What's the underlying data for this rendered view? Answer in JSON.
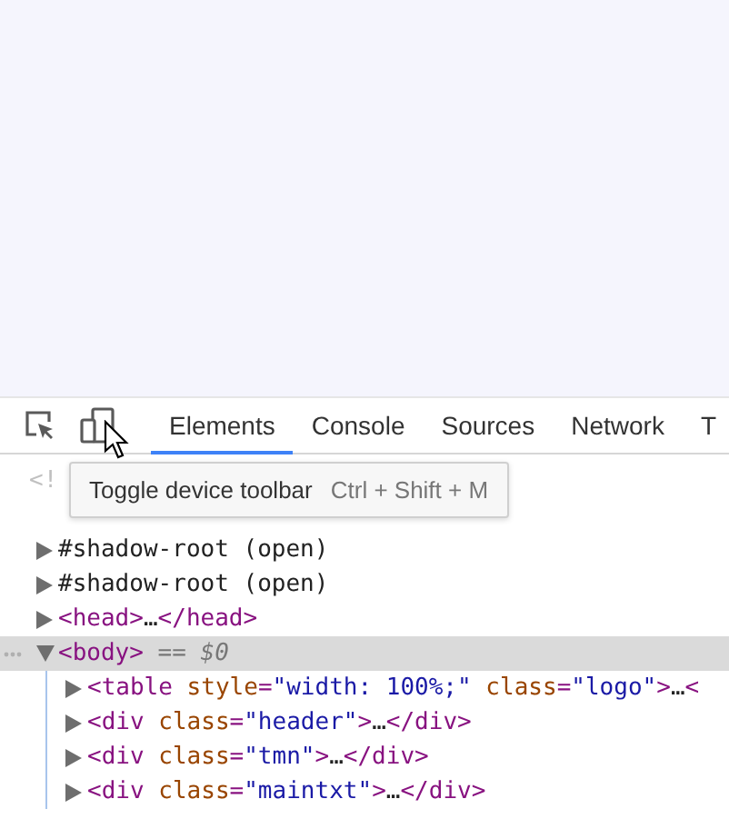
{
  "tabs": [
    {
      "label": "Elements",
      "selected": true
    },
    {
      "label": "Console",
      "selected": false
    },
    {
      "label": "Sources",
      "selected": false
    },
    {
      "label": "Network",
      "selected": false
    },
    {
      "label": "T",
      "selected": false
    }
  ],
  "tooltip": {
    "label": "Toggle device toolbar",
    "shortcut": "Ctrl + Shift + M"
  },
  "tree": [
    {
      "selected": false,
      "tokens": [
        {
          "kind": "doctype",
          "text": "<!"
        }
      ]
    },
    {
      "children": [
        {
          "selected": false,
          "expanded": false,
          "tokens": [
            {
              "kind": "plain",
              "text": "#shadow-root (open)"
            }
          ]
        },
        {
          "selected": false,
          "expanded": false,
          "tokens": [
            {
              "kind": "plain",
              "text": "#shadow-root (open)"
            }
          ]
        },
        {
          "selected": false,
          "expanded": false,
          "tokens": [
            {
              "kind": "tag",
              "text": "<head>"
            },
            {
              "kind": "plain",
              "text": "…"
            },
            {
              "kind": "tag",
              "text": "</head>"
            }
          ]
        },
        {
          "selected": true,
          "expanded": true,
          "tokens": [
            {
              "kind": "tag",
              "text": "<body>"
            },
            {
              "kind": "note",
              "text": " == $0"
            }
          ],
          "children": [
            {
              "selected": false,
              "expanded": false,
              "tokens": [
                {
                  "kind": "tag",
                  "text": "<table"
                },
                {
                  "kind": "attr",
                  "text": " style"
                },
                {
                  "kind": "tag",
                  "text": "="
                },
                {
                  "kind": "value",
                  "text": "\"width: 100%;\""
                },
                {
                  "kind": "attr",
                  "text": " class"
                },
                {
                  "kind": "tag",
                  "text": "="
                },
                {
                  "kind": "value",
                  "text": "\"logo\""
                },
                {
                  "kind": "tag",
                  "text": ">"
                },
                {
                  "kind": "plain",
                  "text": "…"
                },
                {
                  "kind": "tag",
                  "text": "<"
                }
              ]
            },
            {
              "selected": false,
              "expanded": false,
              "tokens": [
                {
                  "kind": "tag",
                  "text": "<div"
                },
                {
                  "kind": "attr",
                  "text": " class"
                },
                {
                  "kind": "tag",
                  "text": "="
                },
                {
                  "kind": "value",
                  "text": "\"header\""
                },
                {
                  "kind": "tag",
                  "text": ">"
                },
                {
                  "kind": "plain",
                  "text": "…"
                },
                {
                  "kind": "tag",
                  "text": "</div>"
                }
              ]
            },
            {
              "selected": false,
              "expanded": false,
              "tokens": [
                {
                  "kind": "tag",
                  "text": "<div"
                },
                {
                  "kind": "attr",
                  "text": " class"
                },
                {
                  "kind": "tag",
                  "text": "="
                },
                {
                  "kind": "value",
                  "text": "\"tmn\""
                },
                {
                  "kind": "tag",
                  "text": ">"
                },
                {
                  "kind": "plain",
                  "text": "…"
                },
                {
                  "kind": "tag",
                  "text": "</div>"
                }
              ]
            },
            {
              "selected": false,
              "expanded": false,
              "tokens": [
                {
                  "kind": "tag",
                  "text": "<div"
                },
                {
                  "kind": "attr",
                  "text": " class"
                },
                {
                  "kind": "tag",
                  "text": "="
                },
                {
                  "kind": "value",
                  "text": "\"maintxt\""
                },
                {
                  "kind": "tag",
                  "text": ">"
                },
                {
                  "kind": "plain",
                  "text": "…"
                },
                {
                  "kind": "tag",
                  "text": "</div>"
                }
              ]
            }
          ]
        }
      ]
    }
  ]
}
